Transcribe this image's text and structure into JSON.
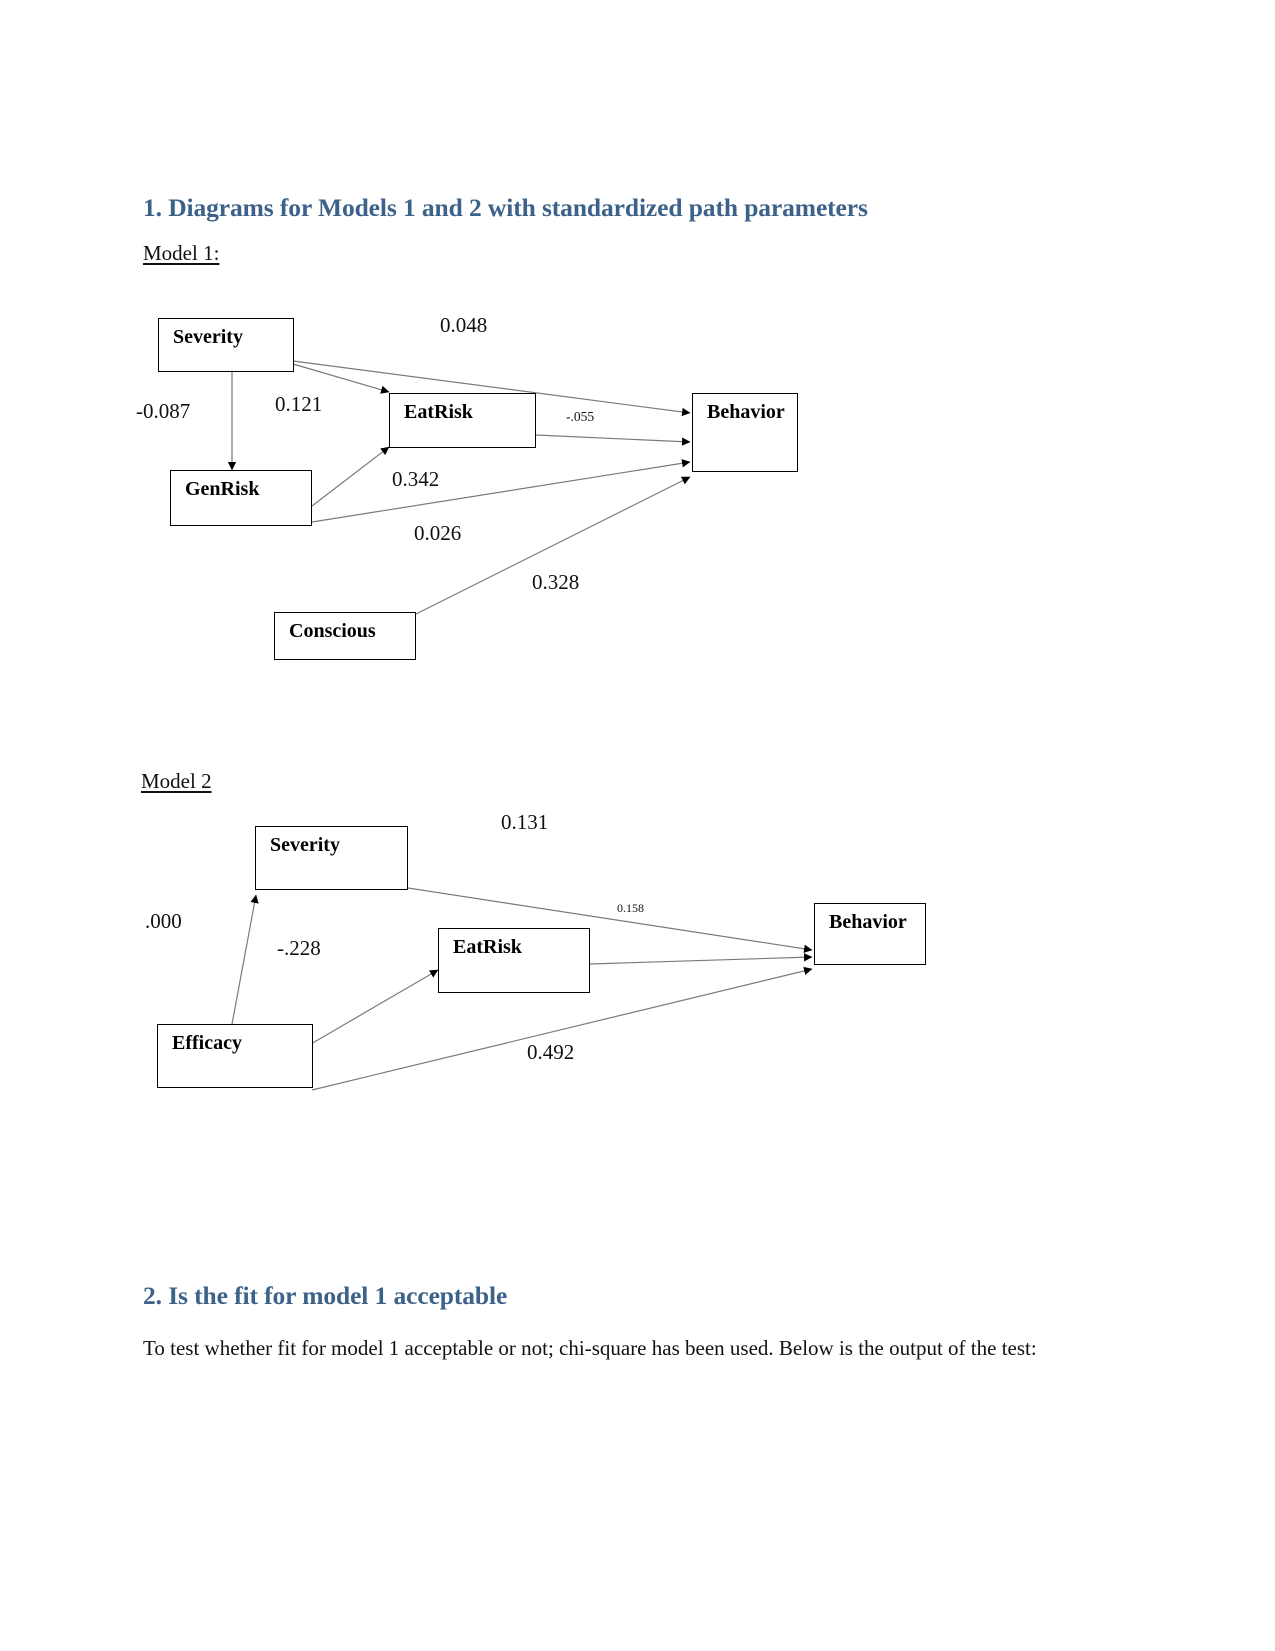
{
  "document": {
    "heading_1": "1. Diagrams for Models 1 and 2 with standardized path parameters",
    "model_1_label": "Model 1:",
    "model_2_label": "Model 2",
    "heading_2": "2. Is the fit for model 1 acceptable",
    "paragraph_1": "To test whether fit for model 1 acceptable or not; chi-square has been used. Below is the output of the test:",
    "heading_color": "#3d6289",
    "text_color": "#111111"
  },
  "model_1": {
    "title": "Model 1",
    "nodes": {
      "severity": "Severity",
      "genrisk": "GenRisk",
      "eatrisk": "EatRisk",
      "conscious": "Conscious",
      "behavior": "Behavior"
    },
    "paths": [
      {
        "id": "severity-genrisk",
        "from": "Severity",
        "to": "GenRisk",
        "coefficient": "-0.087"
      },
      {
        "id": "severity-eatrisk",
        "from": "Severity",
        "to": "EatRisk",
        "coefficient": "0.121"
      },
      {
        "id": "severity-behavior",
        "from": "Severity",
        "to": "Behavior",
        "coefficient": "0.048"
      },
      {
        "id": "genrisk-eatrisk",
        "from": "GenRisk",
        "to": "EatRisk",
        "coefficient": "0.342"
      },
      {
        "id": "eatrisk-behavior",
        "from": "EatRisk",
        "to": "Behavior",
        "coefficient": "-.055"
      },
      {
        "id": "genrisk-behavior",
        "from": "GenRisk",
        "to": "Behavior",
        "coefficient": "0.026"
      },
      {
        "id": "conscious-behavior",
        "from": "Conscious",
        "to": "Behavior",
        "coefficient": "0.328"
      }
    ]
  },
  "model_2": {
    "title": "Model 2",
    "nodes": {
      "severity": "Severity",
      "efficacy": "Efficacy",
      "eatrisk": "EatRisk",
      "behavior": "Behavior"
    },
    "paths": [
      {
        "id": "efficacy-severity",
        "from": "Efficacy",
        "to": "Severity",
        "coefficient": ".000"
      },
      {
        "id": "efficacy-eatrisk",
        "from": "Efficacy",
        "to": "EatRisk",
        "coefficient": "-.228"
      },
      {
        "id": "severity-behavior",
        "from": "Severity",
        "to": "Behavior",
        "coefficient": "0.131"
      },
      {
        "id": "eatrisk-behavior",
        "from": "EatRisk",
        "to": "Behavior",
        "coefficient": "0.158"
      },
      {
        "id": "efficacy-behavior",
        "from": "Efficacy",
        "to": "Behavior",
        "coefficient": "0.492"
      }
    ]
  }
}
